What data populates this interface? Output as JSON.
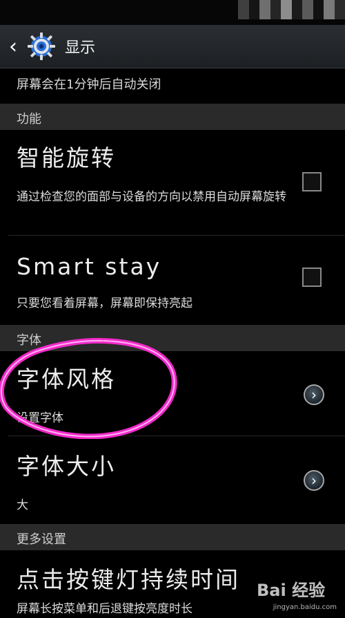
{
  "header": {
    "title": "显示"
  },
  "top_text": "屏幕会在1分钟后自动关闭",
  "sections": {
    "function": "功能",
    "font": "字体",
    "more": "更多设置"
  },
  "items": {
    "smart_rotate": {
      "title": "智能旋转",
      "subtitle": "通过检查您的面部与设备的方向以禁用自动屏幕旋转"
    },
    "smart_stay": {
      "title": "Smart stay",
      "subtitle": "只要您看着屏幕，屏幕即保持亮起"
    },
    "font_style": {
      "title": "字体风格",
      "subtitle": "设置字体"
    },
    "font_size": {
      "title": "字体大小",
      "subtitle": "大"
    },
    "key_light": {
      "title": "点击按键灯持续时间",
      "subtitle": "屏幕长按菜单和后退键按亮度时长"
    }
  },
  "watermark": {
    "main": "Bai 经验",
    "sub": "jingyan.baidu.com"
  },
  "colors": {
    "background": "#000000",
    "section": "#2a2a2a",
    "annotation": "#ff2ad4"
  },
  "icons": {
    "back": "back-icon",
    "settings": "gear-icon",
    "chevron": "chevron-right-icon",
    "checkbox": "checkbox-icon"
  }
}
